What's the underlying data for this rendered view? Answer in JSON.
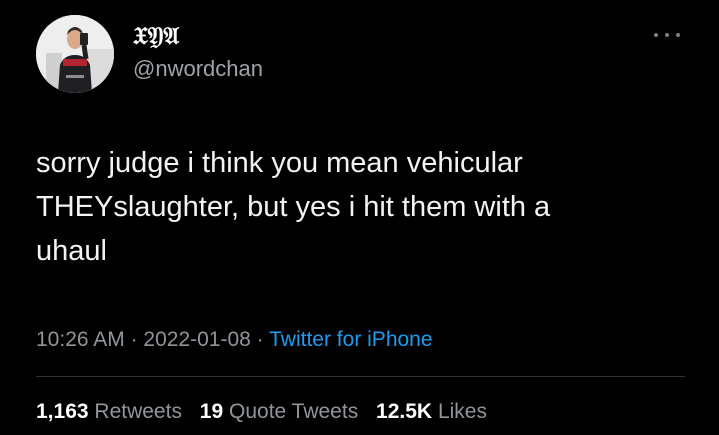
{
  "tweet": {
    "author": {
      "display_name": "𝔛𝔜𝔄",
      "handle": "@nwordchan",
      "avatar_icon": "profile-photo-icon"
    },
    "more_icon": "more-options-icon",
    "text": "sorry judge i think you mean vehicular\nTHEYslaughter, but yes i hit them with a\nuhaul",
    "meta": {
      "time": "10:26 AM",
      "separator": " · ",
      "date": "2022-01-08",
      "source": "Twitter for iPhone"
    },
    "stats": {
      "retweets_count": "1,163",
      "retweets_label": "Retweets",
      "quotes_count": "19",
      "quotes_label": "Quote Tweets",
      "likes_count": "12.5K",
      "likes_label": "Likes"
    },
    "colors": {
      "background": "#000000",
      "text": "#f2f3f4",
      "secondary": "#8f959b",
      "link": "#1d9bf0"
    }
  }
}
